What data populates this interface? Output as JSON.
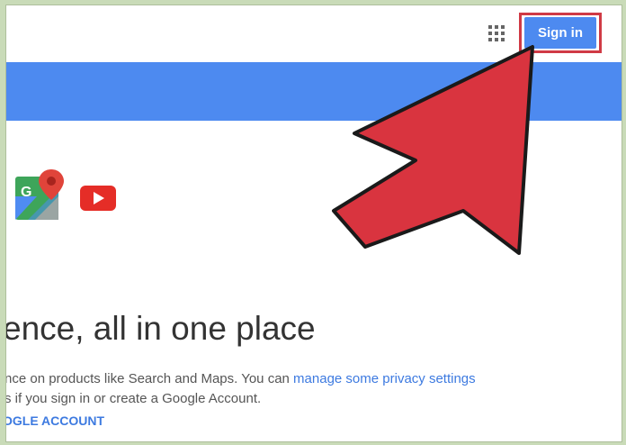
{
  "header": {
    "apps_icon": "apps-grid-icon",
    "signin_label": "Sign in",
    "signin_color": "#4d8af0"
  },
  "banner": {
    "color": "#4d8af0"
  },
  "products": [
    {
      "icon": "google-maps-icon"
    },
    {
      "icon": "youtube-icon"
    }
  ],
  "main": {
    "headline": "ence, all in one place",
    "desc_line1_prefix": "nce on products like Search and Maps. You can ",
    "desc_line1_link": "manage some privacy settings",
    "desc_line2": "s if you sign in or create a Google Account.",
    "cta": "OGLE ACCOUNT"
  },
  "annotation": {
    "arrow_color": "#d9343f",
    "pointer": "red-arrow-icon"
  },
  "colors": {
    "link": "#3d7ae0",
    "text": "#333333"
  }
}
